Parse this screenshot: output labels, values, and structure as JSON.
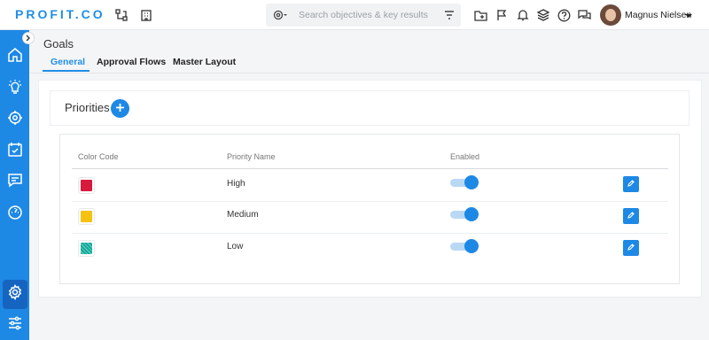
{
  "header": {
    "logo": "PROFIT.CO",
    "search_placeholder": "Search objectives & key results",
    "user_name": "Magnus Nielsen",
    "icons": [
      "org-chart-icon",
      "building-icon",
      "target-dropdown-icon",
      "filter-icon",
      "folder-icon",
      "flag-icon",
      "bell-icon",
      "layers-icon",
      "help-icon",
      "chat-icon",
      "caret-down-icon"
    ]
  },
  "sidebar": {
    "items": [
      "home-icon",
      "lightbulb-icon",
      "target-icon",
      "checklist-icon",
      "message-icon",
      "dashboard-icon",
      "settings-icon",
      "sliders-icon"
    ],
    "active": "settings-icon"
  },
  "page": {
    "title": "Goals",
    "tabs": [
      {
        "label": "General",
        "active": true
      },
      {
        "label": "Approval Flows",
        "active": false
      },
      {
        "label": "Master Layout",
        "active": false
      }
    ]
  },
  "priorities": {
    "title": "Priorities",
    "columns": [
      "Color Code",
      "Priority Name",
      "Enabled"
    ],
    "rows": [
      {
        "name": "High",
        "color": "#d81b3c",
        "enabled": true
      },
      {
        "name": "Medium",
        "color": "#f5c211",
        "enabled": true
      },
      {
        "name": "Low",
        "color": "#14a99a",
        "enabled": true
      }
    ]
  },
  "colors": {
    "accent": "#1e88e5",
    "sidebar": "#1e88e5",
    "sidebar_active": "#1565c0"
  }
}
